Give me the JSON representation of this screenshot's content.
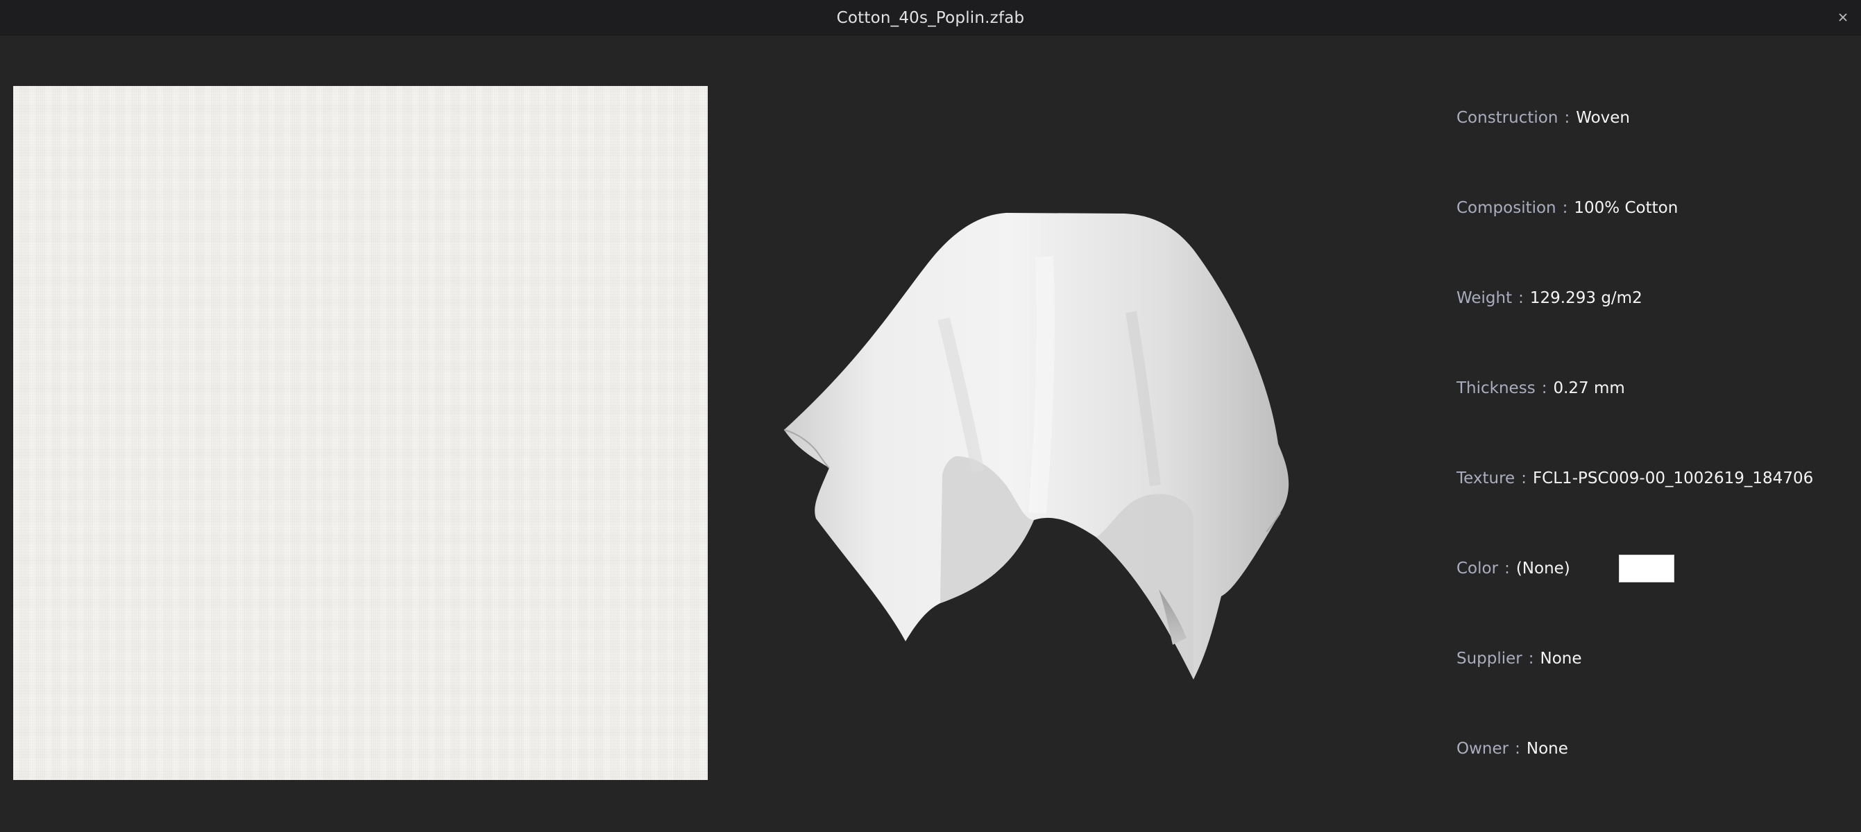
{
  "window": {
    "title": "Cotton_40s_Poplin.zfab",
    "close_icon": "close-icon"
  },
  "properties": [
    {
      "label": "Construction",
      "sep": ":",
      "value": "Woven"
    },
    {
      "label": "Composition",
      "sep": ":",
      "value": "100% Cotton"
    },
    {
      "label": "Weight",
      "sep": ":",
      "value": "129.293 g/m2"
    },
    {
      "label": "Thickness",
      "sep": ":",
      "value": "0.27 mm"
    },
    {
      "label": "Texture",
      "sep": ":",
      "value": "FCL1-PSC009-00_1002619_184706"
    },
    {
      "label": "Color",
      "sep": ":",
      "value": "(None)",
      "swatch": "#ffffff"
    },
    {
      "label": "Supplier",
      "sep": ":",
      "value": "None"
    },
    {
      "label": "Owner",
      "sep": ":",
      "value": "None"
    }
  ],
  "colors": {
    "background": "#252525",
    "titlebar": "#1d1d1f",
    "label": "#a9adbd",
    "value": "#f5f5f5",
    "fabric": "#f1f0ec"
  }
}
